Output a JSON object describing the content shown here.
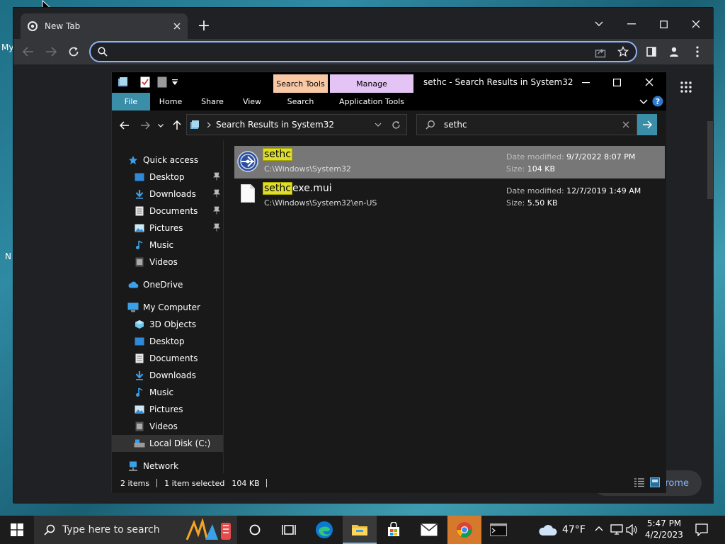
{
  "desktop": {
    "label_my": "My",
    "label_n": "N"
  },
  "browser": {
    "tab_title": "New Tab",
    "new_tab_glyph": "+",
    "omnibox_placeholder": "",
    "partial_button_label": "hrome",
    "window_controls": [
      "minimize",
      "maximize",
      "close"
    ]
  },
  "explorer": {
    "window_title": "sethc - Search Results in System32",
    "context_headers": {
      "search_tools": {
        "label": "Search Tools",
        "color": "#f9c9a6"
      },
      "manage": {
        "label": "Manage",
        "color": "#e3c4f5"
      }
    },
    "ribbon_tabs": {
      "file": "File",
      "home": "Home",
      "share": "Share",
      "view": "View",
      "search": "Search",
      "application_tools": "Application Tools"
    },
    "address": {
      "breadcrumb": "Search Results in System32"
    },
    "search": {
      "value": "sethc"
    },
    "nav": {
      "quick_access": "Quick access",
      "qa_items": [
        "Desktop",
        "Downloads",
        "Documents",
        "Pictures",
        "Music",
        "Videos"
      ],
      "onedrive": "OneDrive",
      "my_computer": "My Computer",
      "pc_items": [
        "3D Objects",
        "Desktop",
        "Documents",
        "Downloads",
        "Music",
        "Pictures",
        "Videos",
        "Local Disk (C:)"
      ],
      "network": "Network"
    },
    "results": [
      {
        "highlight": "sethc",
        "rest": "",
        "path": "C:\\Windows\\System32",
        "date_label": "Date modified:",
        "date": "9/7/2022 8:07 PM",
        "size_label": "Size:",
        "size": "104 KB",
        "selected": true
      },
      {
        "highlight": "sethc",
        "rest": "exe.mui",
        "path": "C:\\Windows\\System32\\en-US",
        "date_label": "Date modified:",
        "date": "12/7/2019 1:49 AM",
        "size_label": "Size:",
        "size": "5.50 KB",
        "selected": false
      }
    ],
    "status": {
      "items": "2 items",
      "selected": "1 item selected",
      "size": "104 KB"
    }
  },
  "taskbar": {
    "search_placeholder": "Type here to search",
    "weather": "47°F",
    "time": "5:47 PM",
    "date": "4/2/2023"
  },
  "colors": {
    "accent": "#3b8ea8",
    "highlight": "#dede30",
    "selected_row": "#777777",
    "chrome_focus": "#8ab4f8"
  }
}
